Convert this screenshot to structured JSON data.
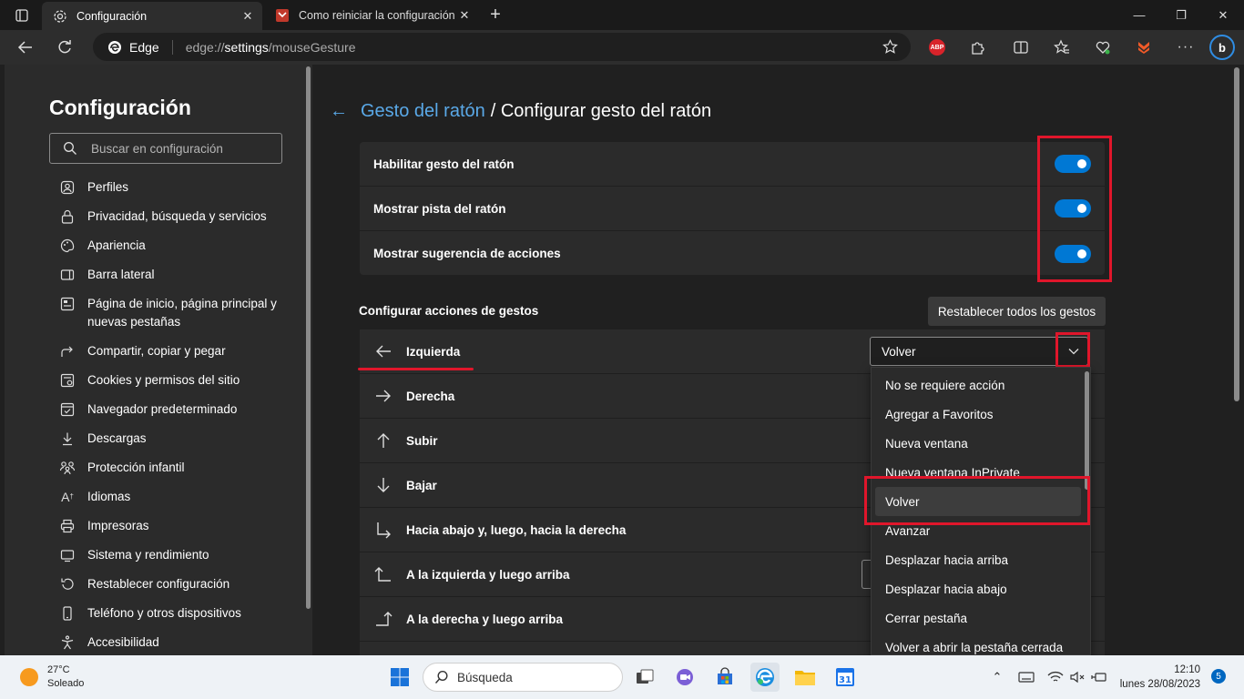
{
  "browser": {
    "tabs": [
      {
        "title": "Configuración",
        "icon": "gear-icon",
        "active": true
      },
      {
        "title": "Como reiniciar la configuración d",
        "icon": "site-favicon-icon",
        "active": false
      }
    ],
    "address": {
      "identity": "Edge",
      "url_prefix": "edge://",
      "url_main": "settings",
      "url_rest": "/mouseGesture"
    }
  },
  "sidebar": {
    "title": "Configuración",
    "search_placeholder": "Buscar en configuración",
    "items": [
      {
        "label": "Perfiles",
        "icon": "profile-icon"
      },
      {
        "label": "Privacidad, búsqueda y servicios",
        "icon": "lock-icon"
      },
      {
        "label": "Apariencia",
        "icon": "palette-icon"
      },
      {
        "label": "Barra lateral",
        "icon": "sidebar-icon"
      },
      {
        "label": "Página de inicio, página principal y nuevas pestañas",
        "icon": "home-page-icon"
      },
      {
        "label": "Compartir, copiar y pegar",
        "icon": "share-icon"
      },
      {
        "label": "Cookies y permisos del sitio",
        "icon": "cookies-icon"
      },
      {
        "label": "Navegador predeterminado",
        "icon": "default-browser-icon"
      },
      {
        "label": "Descargas",
        "icon": "download-icon"
      },
      {
        "label": "Protección infantil",
        "icon": "family-icon"
      },
      {
        "label": "Idiomas",
        "icon": "languages-icon"
      },
      {
        "label": "Impresoras",
        "icon": "printer-icon"
      },
      {
        "label": "Sistema y rendimiento",
        "icon": "system-icon"
      },
      {
        "label": "Restablecer configuración",
        "icon": "reset-icon"
      },
      {
        "label": "Teléfono y otros dispositivos",
        "icon": "phone-icon"
      },
      {
        "label": "Accesibilidad",
        "icon": "accessibility-icon"
      }
    ]
  },
  "main": {
    "breadcrumb_link": "Gesto del ratón",
    "breadcrumb_rest": "/ Configurar gesto del ratón",
    "toggles": [
      {
        "label": "Habilitar gesto del ratón",
        "on": true
      },
      {
        "label": "Mostrar pista del ratón",
        "on": true
      },
      {
        "label": "Mostrar sugerencia de acciones",
        "on": true
      }
    ],
    "section_title": "Configurar acciones de gestos",
    "reset_button": "Restablecer todos los gestos",
    "gestures": [
      {
        "label": "Izquierda",
        "icon": "arrow-left-icon"
      },
      {
        "label": "Derecha",
        "icon": "arrow-right-icon"
      },
      {
        "label": "Subir",
        "icon": "arrow-up-icon"
      },
      {
        "label": "Bajar",
        "icon": "arrow-down-icon"
      },
      {
        "label": "Hacia abajo y, luego, hacia la derecha",
        "icon": "down-then-right-icon"
      },
      {
        "label": "A la izquierda y luego arriba",
        "icon": "left-then-up-icon"
      },
      {
        "label": "A la derecha y luego arriba",
        "icon": "right-then-up-icon"
      }
    ],
    "select_value": "Volver",
    "dropdown_options": [
      "No se requiere acción",
      "Agregar a Favoritos",
      "Nueva ventana",
      "Nueva ventana InPrivate",
      "Volver",
      "Avanzar",
      "Desplazar hacia arriba",
      "Desplazar hacia abajo",
      "Cerrar pestaña",
      "Volver a abrir la pestaña cerrada"
    ],
    "selected_option": "Volver"
  },
  "taskbar": {
    "temperature": "27°C",
    "weather": "Soleado",
    "search_placeholder": "Búsqueda",
    "time": "12:10",
    "date": "lunes 28/08/2023",
    "notifications": "5"
  },
  "colors": {
    "accent": "#0078d4",
    "link": "#5aa9e8",
    "highlight": "#e0162b"
  }
}
